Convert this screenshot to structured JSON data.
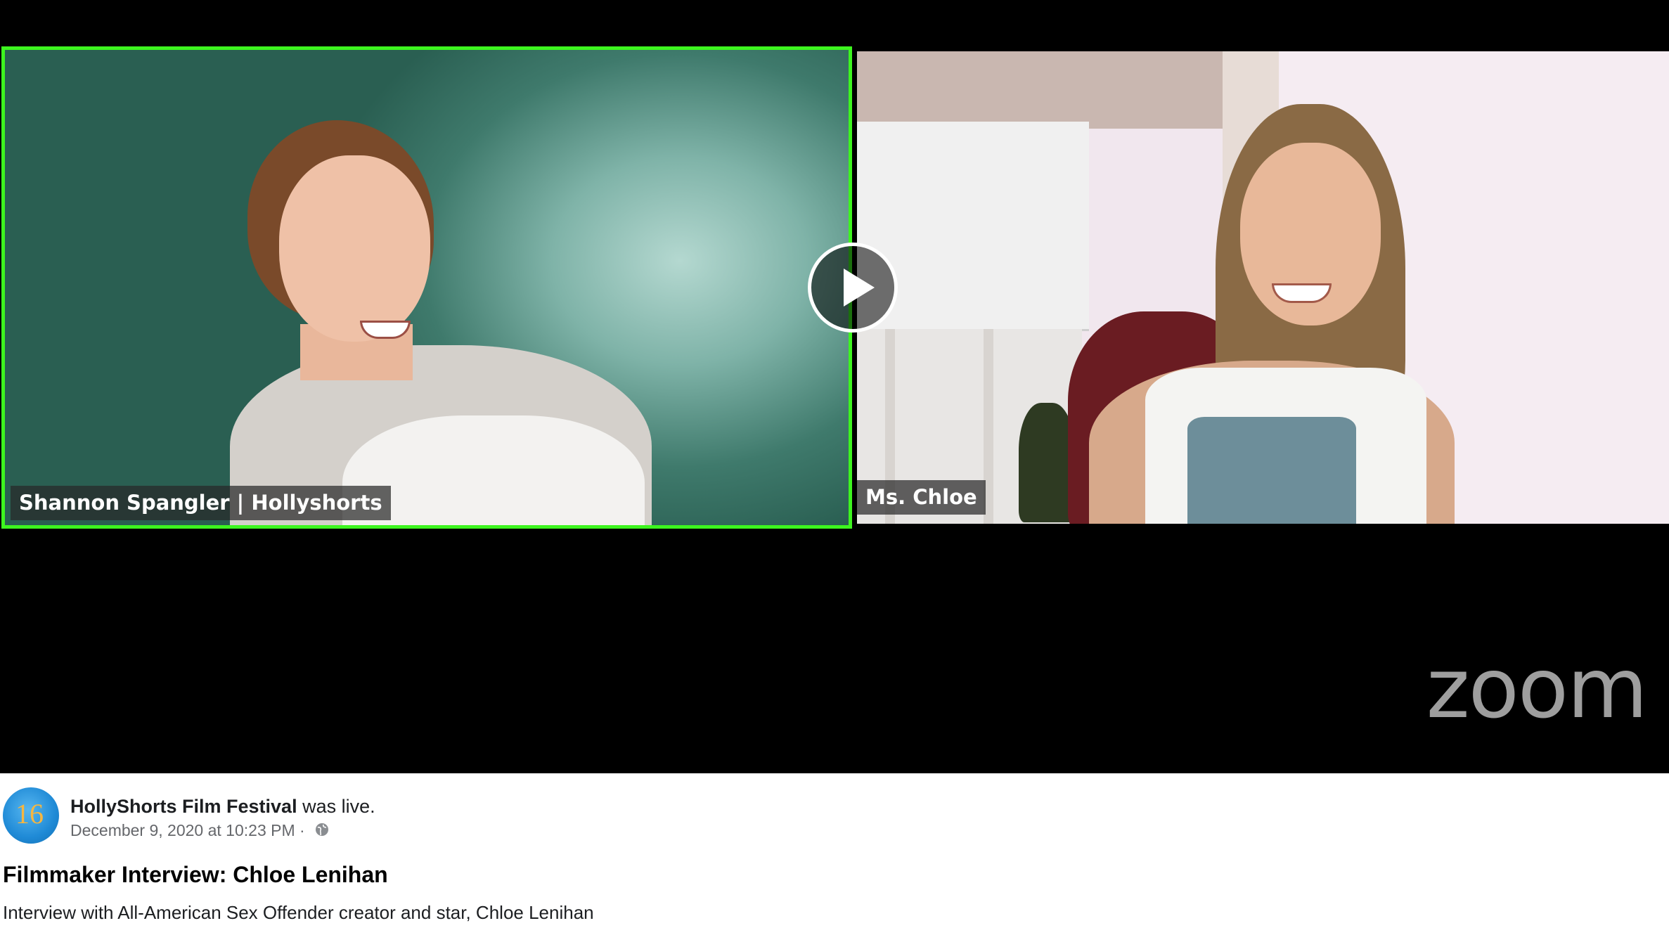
{
  "video": {
    "participants": [
      {
        "name": "Shannon Spangler | Hollyshorts",
        "active_speaker": true
      },
      {
        "name": "Ms. Chloe",
        "active_speaker": false
      }
    ],
    "watermark": "zoom",
    "play_icon": "play-icon",
    "active_speaker_color": "#3df51f"
  },
  "post": {
    "avatar_text": "16",
    "page_name": "HollyShorts Film Festival",
    "status_text": " was live.",
    "timestamp": "December 9, 2020 at 10:23 PM",
    "separator": " · ",
    "audience_icon": "globe-icon",
    "title": "Filmmaker Interview: Chloe Lenihan",
    "description": "Interview with All-American Sex Offender creator and star, Chloe Lenihan"
  }
}
